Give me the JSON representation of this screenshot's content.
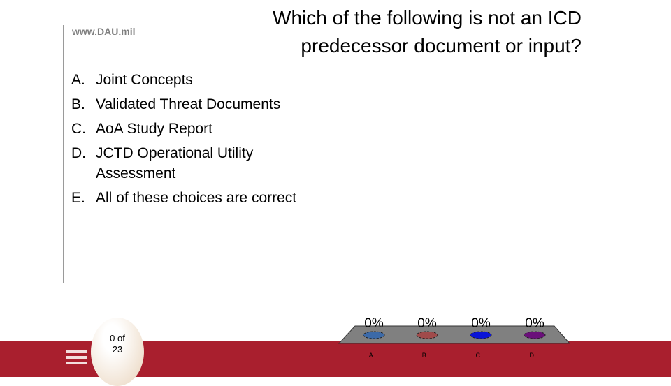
{
  "header": {
    "logo": "www.DAU.mil",
    "question": "Which of the following is not an ICD predecessor document or input?"
  },
  "answers": [
    {
      "letter": "A.",
      "text": "Joint Concepts"
    },
    {
      "letter": "B.",
      "text": "Validated Threat Documents"
    },
    {
      "letter": "C.",
      "text": "AoA Study Report"
    },
    {
      "letter": "D.",
      "text": "JCTD Operational  Utility Assessment"
    },
    {
      "letter": "E.",
      "text": "All of these choices are correct"
    }
  ],
  "counter": {
    "line1": "0 of",
    "line2": "23"
  },
  "chart_data": {
    "type": "bar",
    "categories": [
      "A.",
      "B.",
      "C.",
      "D."
    ],
    "values": [
      0,
      0,
      0,
      0
    ],
    "value_labels": [
      "0%",
      "0%",
      "0%",
      "0%"
    ],
    "colors": [
      "#3c6aa8",
      "#a04b4b",
      "#0a14d8",
      "#6a0f7a"
    ],
    "platform_color": "#808080"
  }
}
